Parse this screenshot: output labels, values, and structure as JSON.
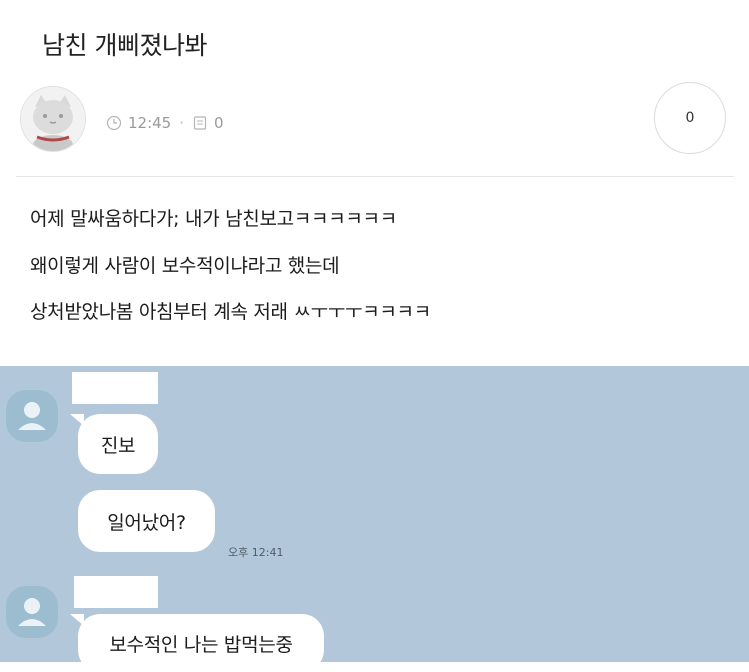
{
  "post": {
    "title": "남친 개삐졌나봐",
    "time": "12:45",
    "comment_count": "0",
    "like_count": "0",
    "lines": [
      "어제 말싸움하다가; 내가 남친보고ㅋㅋㅋㅋㅋㅋ",
      "왜이렇게 사람이 보수적이냐라고 했는데",
      "상처받았나봄 아침부터 계속 저래 ㅆㅜㅜㅜㅋㅋㅋㅋ"
    ],
    "icons": {
      "clock": "clock-icon",
      "comment": "comment-icon",
      "avatar": "cat-avatar"
    }
  },
  "chat": {
    "background": "#b2c7d9",
    "messages": [
      {
        "text": "진보"
      },
      {
        "text": "일어났어?",
        "time": "오후 12:41"
      },
      {
        "text": "보수적인 나는 밥먹는중"
      }
    ]
  }
}
